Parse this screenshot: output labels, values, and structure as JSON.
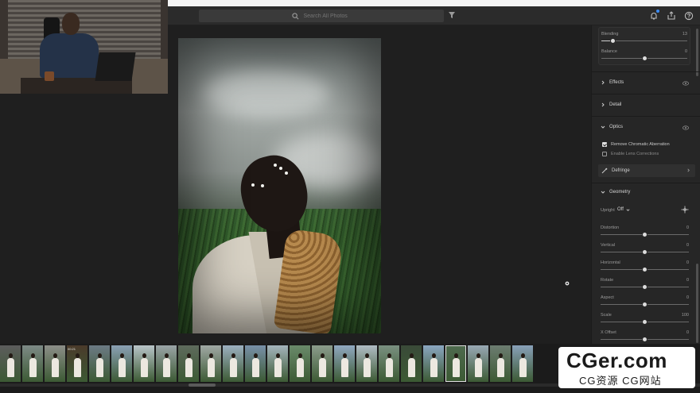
{
  "search": {
    "placeholder": "Search All Photos"
  },
  "colors": {
    "accent": "#3b8bf5",
    "panel": "#262626",
    "background": "#1f1f1f"
  },
  "light_panel": {
    "blending": {
      "label": "Blending",
      "value": "13",
      "level": 0.13
    },
    "balance": {
      "label": "Balance",
      "value": "0",
      "level": 0.5
    }
  },
  "sections": {
    "effects": "Effects",
    "detail": "Detail",
    "optics": "Optics",
    "geometry": "Geometry"
  },
  "optics": {
    "remove_ca": {
      "label": "Remove Chromatic Aberration",
      "checked": true
    },
    "lens_corrections": {
      "label": "Enable Lens Corrections",
      "checked": false
    },
    "defringe": "Defringe"
  },
  "geometry": {
    "upright_label": "Upright",
    "upright_value": "Off",
    "sliders": [
      {
        "label": "Distortion",
        "value": "0",
        "level": 0.5
      },
      {
        "label": "Vertical",
        "value": "0",
        "level": 0.5
      },
      {
        "label": "Horizontal",
        "value": "0",
        "level": 0.5
      },
      {
        "label": "Rotate",
        "value": "0",
        "level": 0.5
      },
      {
        "label": "Aspect",
        "value": "0",
        "level": 0.5
      },
      {
        "label": "Scale",
        "value": "100",
        "level": 0.5
      },
      {
        "label": "X Offset",
        "value": "0",
        "level": 0.5
      }
    ]
  },
  "filmstrip": {
    "video_duration": "00:21"
  },
  "watermark": {
    "main": "CGer.com",
    "sub": "CG资源 CG网站"
  }
}
